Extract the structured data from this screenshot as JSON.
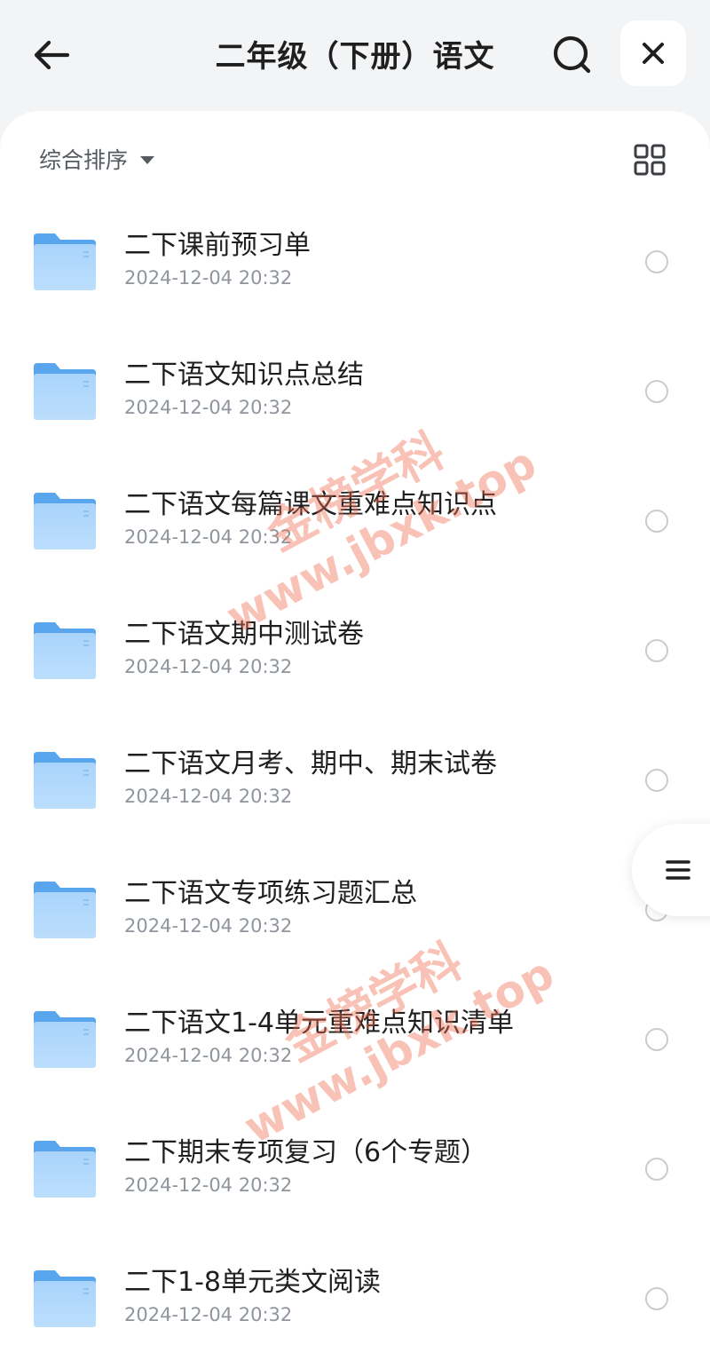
{
  "header": {
    "title": "二年级（下册）语文"
  },
  "icons": {
    "back": "arrow-left-icon",
    "search": "search-icon",
    "close": "close-icon",
    "grid": "grid-view-icon",
    "folder": "folder-icon",
    "menu": "menu-icon"
  },
  "toolbar": {
    "sort_label": "综合排序"
  },
  "colors": {
    "folder_light": "#a9d4fb",
    "folder_dark": "#5aa6ee",
    "background": "#f3f4f6"
  },
  "items": [
    {
      "name": "二下课前预习单",
      "date": "2024-12-04 20:32"
    },
    {
      "name": "二下语文知识点总结",
      "date": "2024-12-04 20:32"
    },
    {
      "name": "二下语文每篇课文重难点知识点",
      "date": "2024-12-04 20:32"
    },
    {
      "name": "二下语文期中测试卷",
      "date": "2024-12-04 20:32"
    },
    {
      "name": "二下语文月考、期中、期末试卷",
      "date": "2024-12-04 20:32"
    },
    {
      "name": "二下语文专项练习题汇总",
      "date": "2024-12-04 20:32"
    },
    {
      "name": "二下语文1-4单元重难点知识清单",
      "date": "2024-12-04 20:32"
    },
    {
      "name": "二下期末专项复习（6个专题）",
      "date": "2024-12-04 20:32"
    },
    {
      "name": "二下1-8单元类文阅读",
      "date": "2024-12-04 20:32"
    }
  ],
  "watermark": {
    "line1": "金榜学科",
    "line2": "www.jbxk.top"
  }
}
